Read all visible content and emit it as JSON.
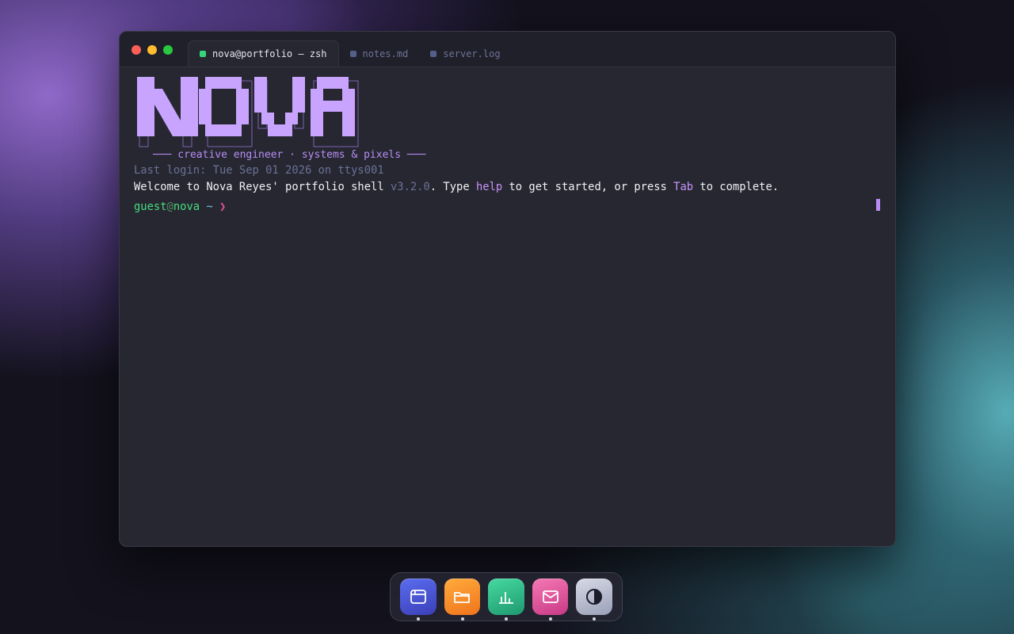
{
  "window": {
    "tabs": [
      {
        "label": "nova@portfolio — zsh",
        "active": true,
        "dot_color": "#37d67a"
      },
      {
        "label": "notes.md",
        "active": false
      },
      {
        "label": "server.log",
        "active": false
      }
    ]
  },
  "terminal": {
    "banner_text": "NOVA",
    "tagline": "─── creative engineer · systems & pixels ───",
    "last_login": "Last login: Tue Sep 01 2026 on ttys001",
    "welcome": {
      "pre": "Welcome to Nova Reyes' portfolio shell ",
      "version": "v3.2.0",
      "mid1": ". Type ",
      "help": "help",
      "mid2": " to get started, or press ",
      "tab": "Tab",
      "post": " to complete."
    },
    "prompt": {
      "user": "guest",
      "at": "@",
      "host": "nova",
      "path": " ~ ",
      "arrow": "❯"
    }
  },
  "dock": {
    "apps": [
      {
        "name": "browser",
        "icon": "browser-window-icon"
      },
      {
        "name": "files",
        "icon": "folder-icon"
      },
      {
        "name": "stats",
        "icon": "bar-chart-icon"
      },
      {
        "name": "mail",
        "icon": "mail-icon"
      },
      {
        "name": "theme",
        "icon": "contrast-icon"
      }
    ]
  },
  "colors": {
    "accent": "#c8a4ff",
    "prompt_green": "#46dd7e",
    "prompt_arrow": "#e0529b",
    "muted": "#6a7196"
  }
}
